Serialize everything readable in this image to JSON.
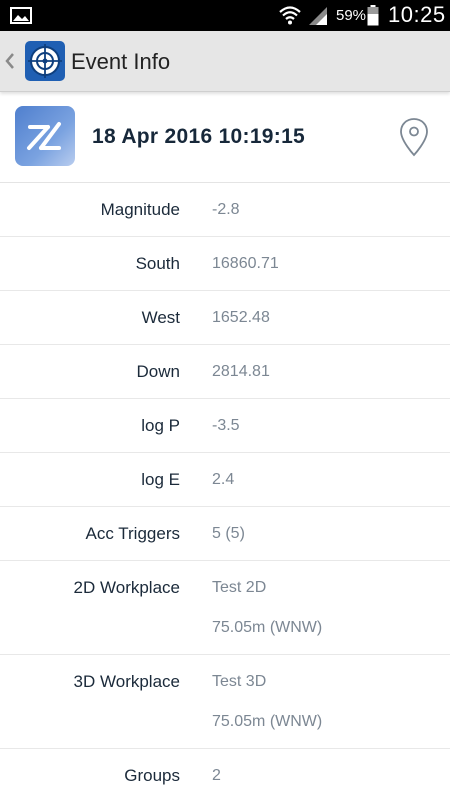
{
  "status_bar": {
    "battery_percent": "59%",
    "time": "10:25"
  },
  "action_bar": {
    "title": "Event Info"
  },
  "event": {
    "datetime": "18 Apr 2016 10:19:15"
  },
  "fields": [
    {
      "label": "Magnitude",
      "values": [
        "-2.8"
      ]
    },
    {
      "label": "South",
      "values": [
        "16860.71"
      ]
    },
    {
      "label": "West",
      "values": [
        "1652.48"
      ]
    },
    {
      "label": "Down",
      "values": [
        "2814.81"
      ]
    },
    {
      "label": "log P",
      "values": [
        "-3.5"
      ]
    },
    {
      "label": "log E",
      "values": [
        "2.4"
      ]
    },
    {
      "label": "Acc Triggers",
      "values": [
        "5 (5)"
      ]
    },
    {
      "label": "2D Workplace",
      "values": [
        "Test 2D",
        "75.05m (WNW)"
      ]
    },
    {
      "label": "3D Workplace",
      "values": [
        "Test 3D",
        "75.05m (WNW)"
      ]
    },
    {
      "label": "Groups",
      "values": [
        "2"
      ]
    }
  ],
  "colors": {
    "action_bar_bg": "#e6e6e6",
    "app_logo_bg": "#1f5fb3",
    "label_text": "#1b2a3a",
    "value_text": "#7c8793"
  },
  "icons": [
    "image-icon",
    "wifi-icon",
    "signal-icon",
    "battery-icon",
    "back-chevron-icon",
    "target-logo-icon",
    "event-logo-icon",
    "location-pin-icon"
  ]
}
